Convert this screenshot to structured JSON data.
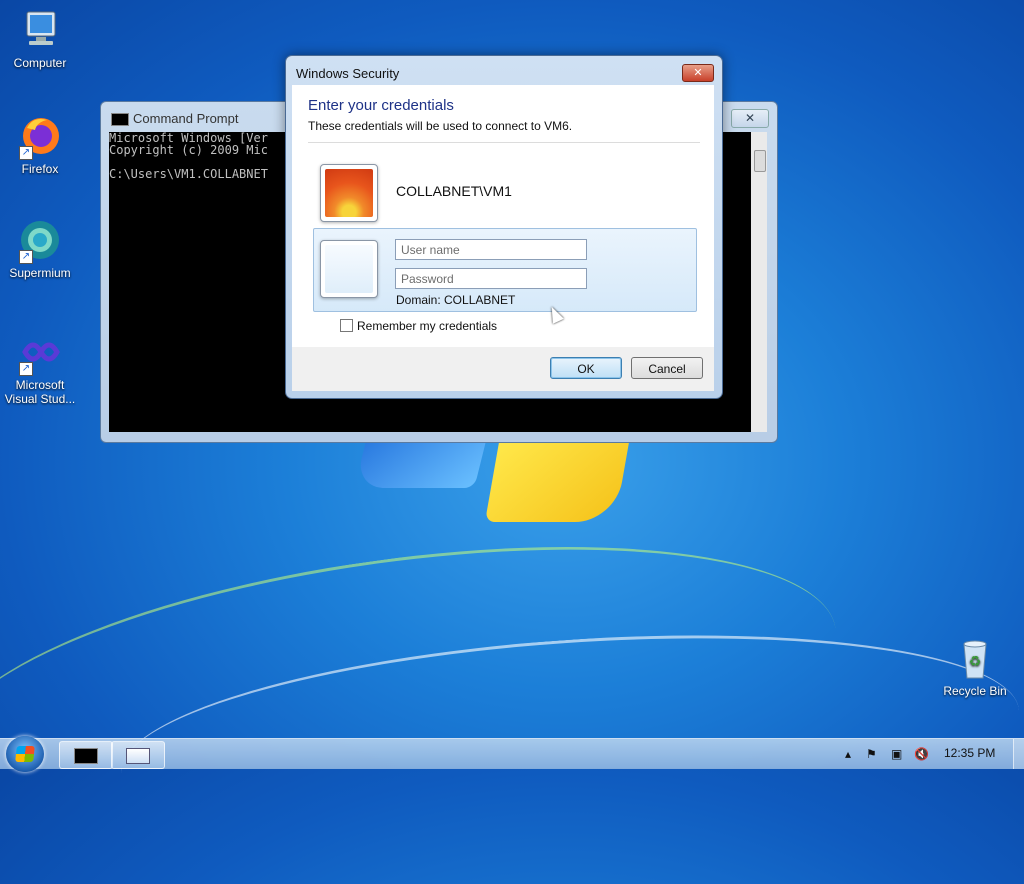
{
  "desktop": {
    "icons": [
      {
        "label": "Computer",
        "icon": "computer-icon"
      },
      {
        "label": "Firefox",
        "icon": "firefox-icon"
      },
      {
        "label": "Supermium",
        "icon": "supermium-icon"
      },
      {
        "label": "Microsoft Visual Stud...",
        "icon": "visual-studio-icon"
      },
      {
        "label": "Recycle Bin",
        "icon": "recycle-bin-icon"
      }
    ]
  },
  "cmd_window": {
    "title": "Command Prompt",
    "lines": [
      "Microsoft Windows [Ver",
      "Copyright (c) 2009 Mic",
      "",
      "C:\\Users\\VM1.COLLABNET"
    ]
  },
  "dialog": {
    "title": "Windows Security",
    "heading": "Enter your credentials",
    "subheading": "These credentials will be used to connect to VM6.",
    "user1_name": "COLLABNET\\VM1",
    "username_placeholder": "User name",
    "password_placeholder": "Password",
    "domain_text": "Domain: COLLABNET",
    "remember_label": "Remember my credentials",
    "ok_label": "OK",
    "cancel_label": "Cancel"
  },
  "taskbar": {
    "clock": "12:35 PM",
    "tray_icons": [
      "show-hidden-icons-icon",
      "action-center-flag-icon",
      "network-icon",
      "volume-muted-icon"
    ],
    "pinned": [
      "command-prompt-taskbar-icon",
      "remote-desktop-taskbar-icon"
    ]
  },
  "colors": {
    "heading": "#1e3287",
    "desktop": "#1c7fd8"
  }
}
